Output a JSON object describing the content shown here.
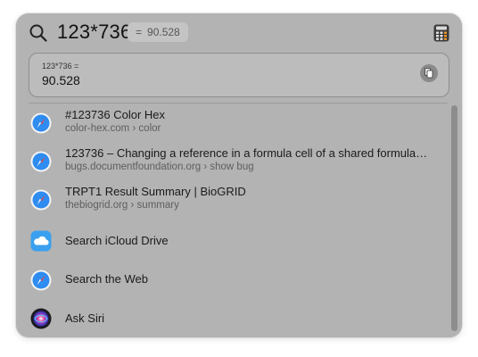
{
  "search": {
    "query": "123*736",
    "inline_result_equals": "=",
    "inline_result_value": "90.528"
  },
  "calculator": {
    "expression": "123*736 =",
    "value": "90.528"
  },
  "results": [
    {
      "title": "#123736 Color Hex",
      "subtitle": "color-hex.com › color",
      "icon": "safari-icon"
    },
    {
      "title": "123736 – Changing a reference in a formula cell of a shared formula…",
      "subtitle": "bugs.documentfoundation.org › show bug",
      "icon": "safari-icon"
    },
    {
      "title": "TRPT1 Result Summary | BioGRID",
      "subtitle": "thebiogrid.org › summary",
      "icon": "safari-icon"
    },
    {
      "title": "Search iCloud Drive",
      "subtitle": "",
      "icon": "icloud-icon"
    },
    {
      "title": "Search the Web",
      "subtitle": "",
      "icon": "safari-icon"
    },
    {
      "title": "Ask Siri",
      "subtitle": "",
      "icon": "siri-icon"
    }
  ],
  "colors": {
    "panel_bg": "#b3b3b3",
    "safari_blue": "#2f8cf0",
    "icloud_blue": "#3aa0ef"
  }
}
